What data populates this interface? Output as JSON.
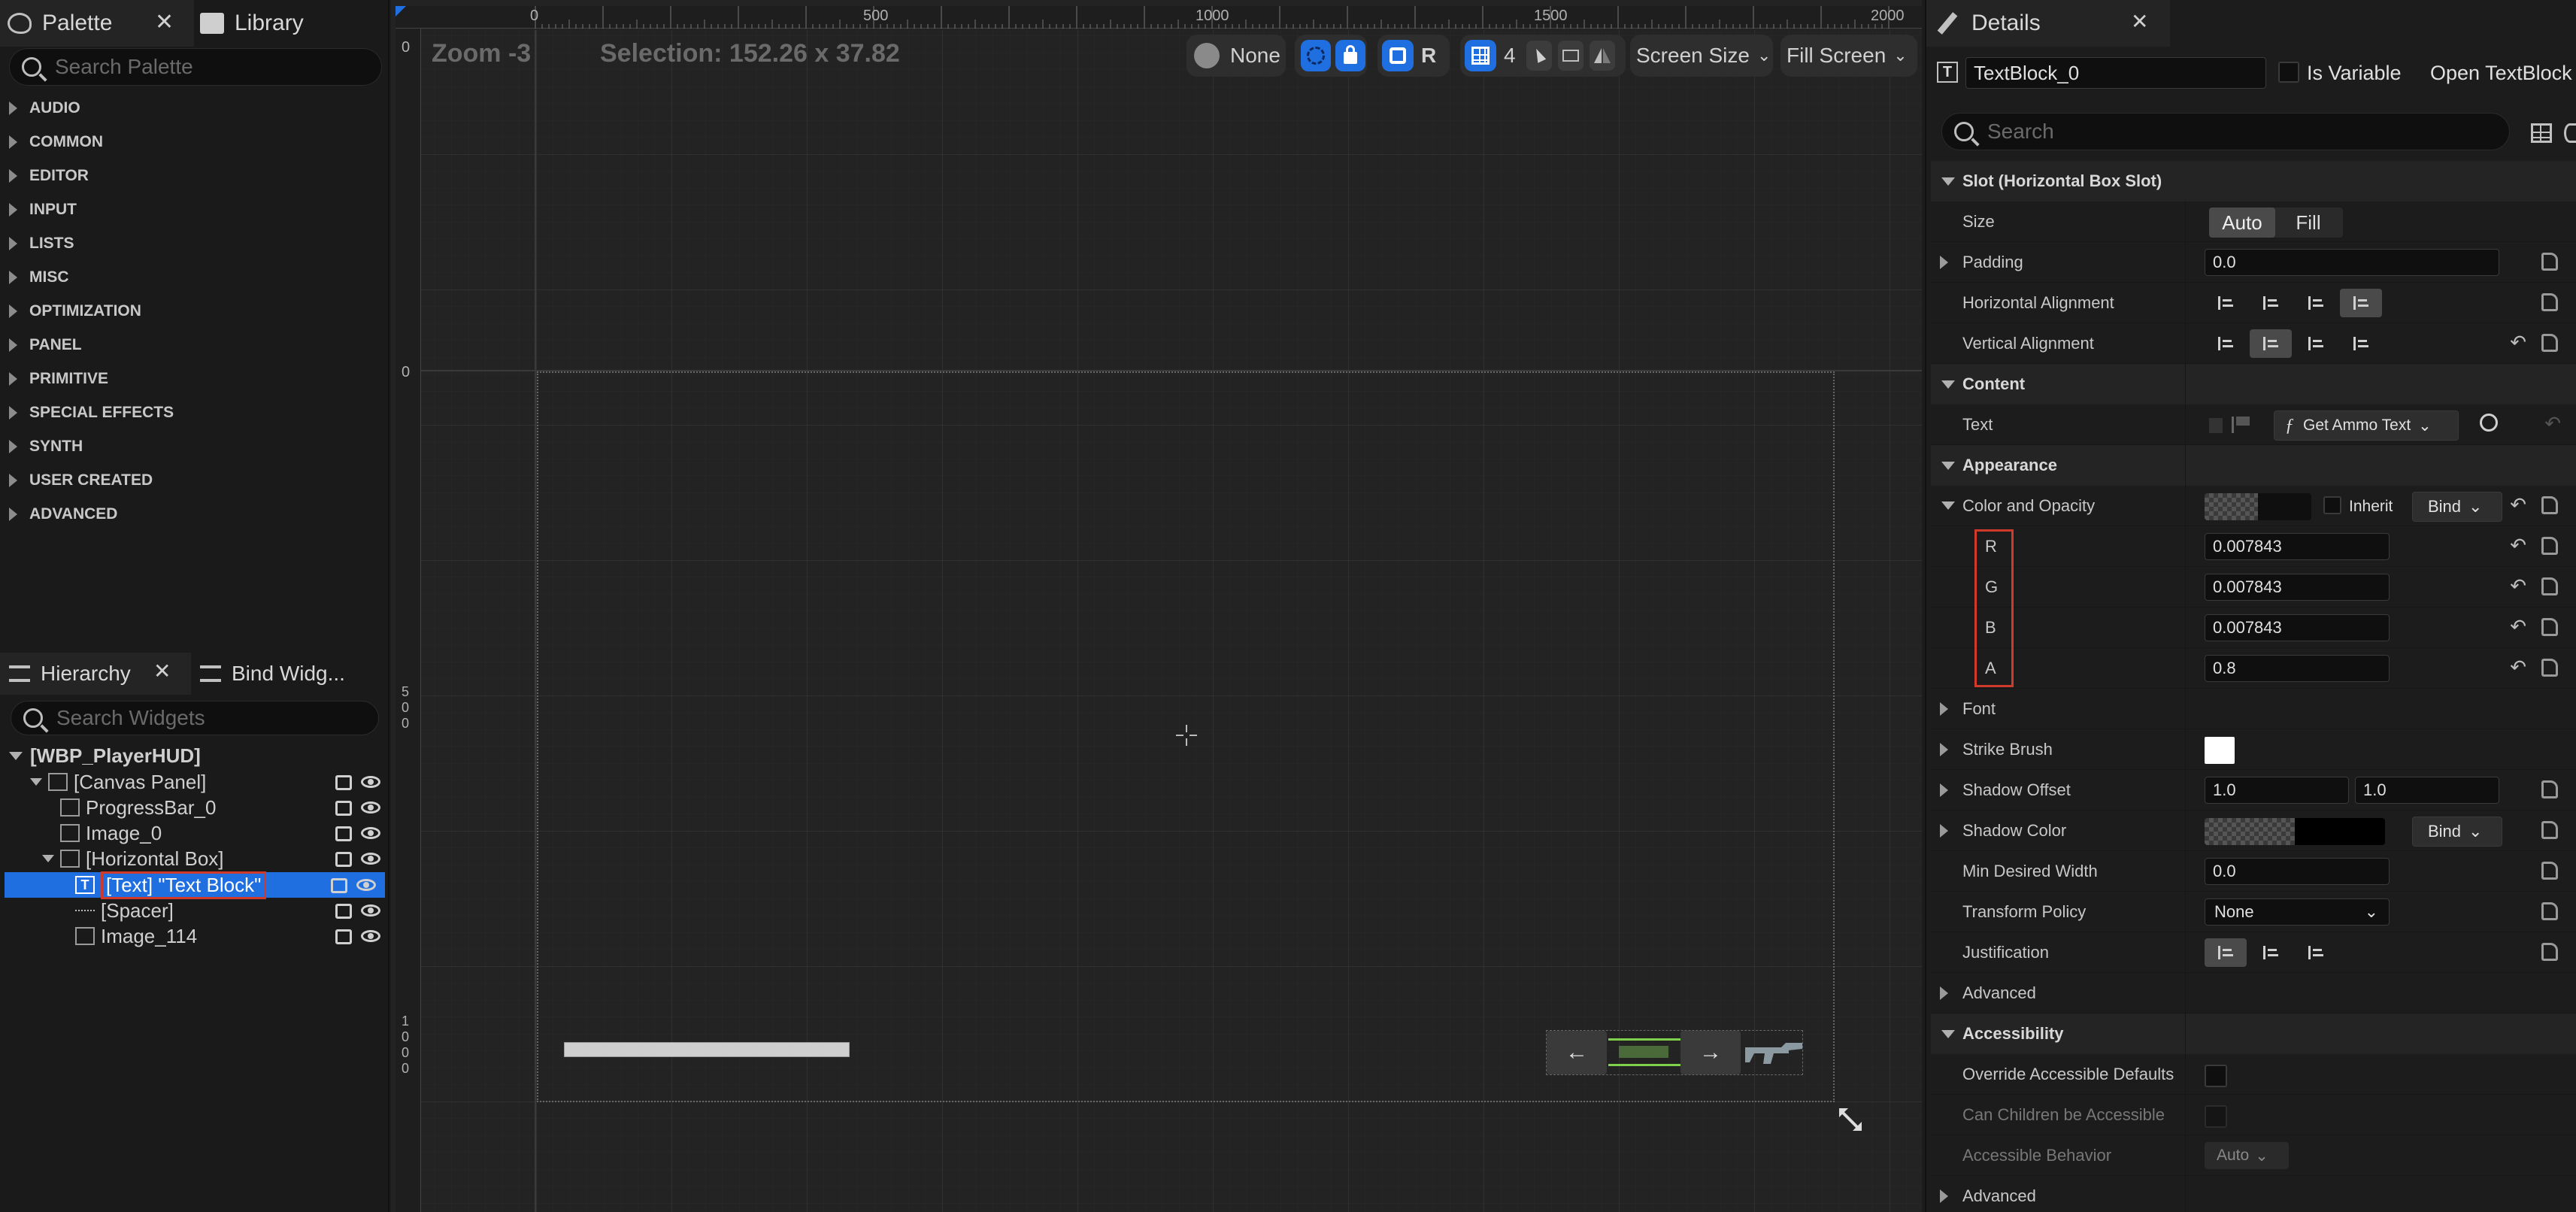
{
  "palette": {
    "tab_label": "Palette",
    "library_tab_label": "Library",
    "search_placeholder": "Search Palette",
    "categories": [
      "AUDIO",
      "COMMON",
      "EDITOR",
      "INPUT",
      "LISTS",
      "MISC",
      "OPTIMIZATION",
      "PANEL",
      "PRIMITIVE",
      "SPECIAL EFFECTS",
      "SYNTH",
      "USER CREATED",
      "ADVANCED"
    ]
  },
  "hierarchy": {
    "tab_label": "Hierarchy",
    "bind_tab_label": "Bind Widg...",
    "search_placeholder": "Search Widgets",
    "root": "[WBP_PlayerHUD]",
    "items": [
      "[Canvas Panel]",
      "ProgressBar_0",
      "Image_0",
      "[Horizontal Box]",
      "[Text] \"Text Block\"",
      "[Spacer]",
      "Image_114"
    ]
  },
  "viewport": {
    "zoom": "Zoom -3",
    "selection": "Selection: 152.26 x 37.82",
    "ruler_top": [
      "0",
      "500",
      "1000",
      "1500",
      "2000"
    ],
    "ruler_left_0a": "0",
    "ruler_left_0b": "0",
    "ruler_left_500": [
      "5",
      "0",
      "0"
    ],
    "ruler_left_1000": [
      "1",
      "0",
      "0",
      "0"
    ],
    "toolbar": {
      "none_label": "None",
      "r_label": "R",
      "grid_num": "4",
      "screen_size": "Screen Size",
      "fill_screen": "Fill Screen"
    },
    "hud_left_arrow": "←",
    "hud_right_arrow": "→"
  },
  "details": {
    "tab_label": "Details",
    "widget_name": "TextBlock_0",
    "is_variable": "Is Variable",
    "open_link": "Open TextBlock",
    "search_placeholder": "Search",
    "slot_section": "Slot (Horizontal Box Slot)",
    "size_label": "Size",
    "size_auto": "Auto",
    "size_fill": "Fill",
    "padding_label": "Padding",
    "padding_value": "0.0",
    "halign_label": "Horizontal Alignment",
    "valign_label": "Vertical Alignment",
    "content_section": "Content",
    "text_label": "Text",
    "text_binding": "Get Ammo Text",
    "appearance_section": "Appearance",
    "color_label": "Color and Opacity",
    "inherit_label": "Inherit",
    "bind_label": "Bind",
    "r_label": "R",
    "r_value": "0.007843",
    "g_label": "G",
    "g_value": "0.007843",
    "b_label": "B",
    "b_value": "0.007843",
    "a_label": "A",
    "a_value": "0.8",
    "font_label": "Font",
    "strike_label": "Strike Brush",
    "shadow_offset_label": "Shadow Offset",
    "shadow_x": "1.0",
    "shadow_y": "1.0",
    "shadow_color_label": "Shadow Color",
    "shadow_bind": "Bind",
    "min_width_label": "Min Desired Width",
    "min_width_value": "0.0",
    "transform_label": "Transform Policy",
    "transform_value": "None",
    "justification_label": "Justification",
    "advanced_label": "Advanced",
    "accessibility_section": "Accessibility",
    "override_label": "Override Accessible Defaults",
    "children_label": "Can Children be Accessible",
    "behavior_label": "Accessible Behavior",
    "behavior_value": "Auto",
    "advanced2_label": "Advanced"
  },
  "colors": {
    "selection_blue": "#1f6fe0",
    "highlight_red": "#d03a2a",
    "progress_green": "#7fd04a"
  }
}
